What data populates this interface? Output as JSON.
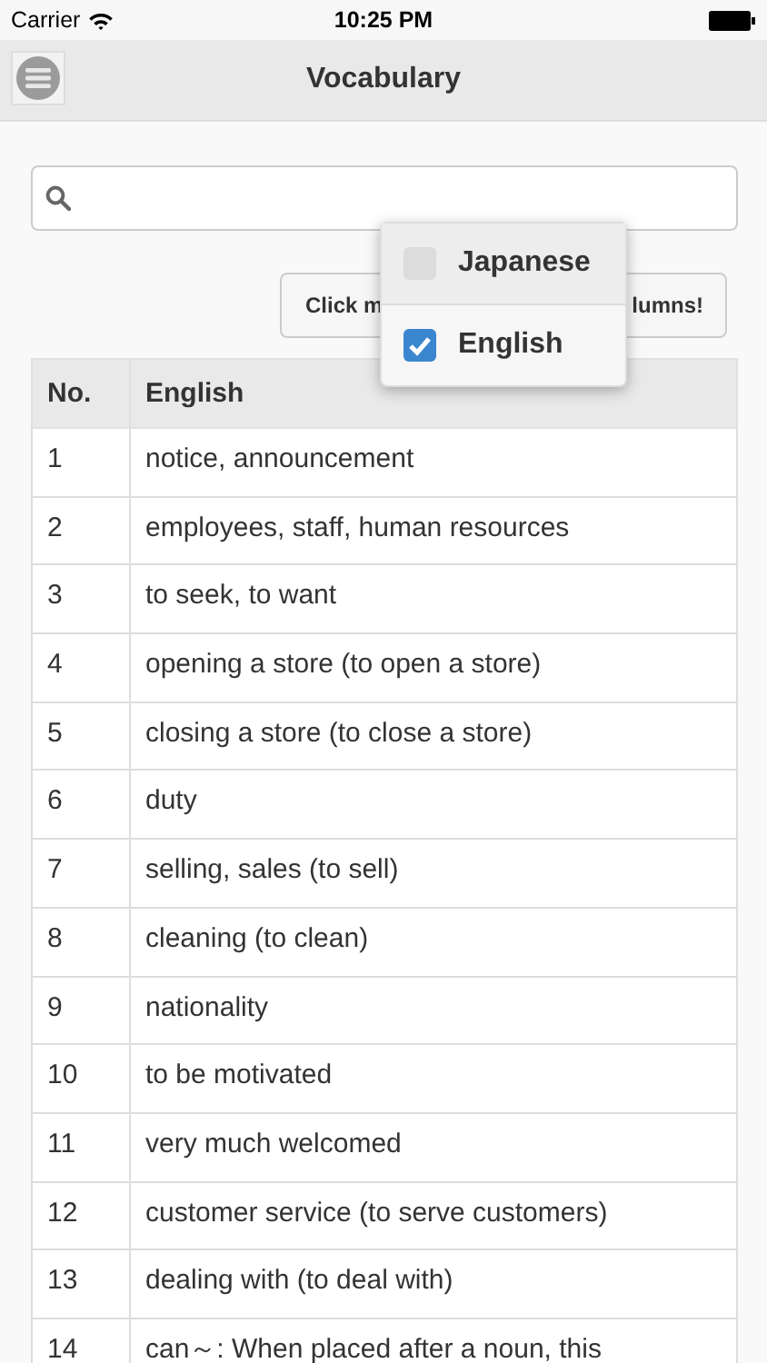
{
  "status_bar": {
    "carrier": "Carrier",
    "time": "10:25 PM"
  },
  "nav": {
    "title": "Vocabulary"
  },
  "columns_button": {
    "label_start": "Click m",
    "label_end": "lumns!"
  },
  "column_menu": [
    {
      "label": "Japanese",
      "checked": false
    },
    {
      "label": "English",
      "checked": true
    }
  ],
  "table": {
    "columns": [
      "No.",
      "English"
    ],
    "rows": [
      [
        "1",
        "notice, announcement"
      ],
      [
        "2",
        "employees, staff, human resources"
      ],
      [
        "3",
        "to seek, to want"
      ],
      [
        "4",
        "opening a store (to open a store)"
      ],
      [
        "5",
        "closing a store (to close a store)"
      ],
      [
        "6",
        "duty"
      ],
      [
        "7",
        "selling, sales (to sell)"
      ],
      [
        "8",
        "cleaning (to clean)"
      ],
      [
        "9",
        "nationality"
      ],
      [
        "10",
        "to be motivated"
      ],
      [
        "11",
        "very much welcomed"
      ],
      [
        "12",
        "customer service (to serve customers)"
      ],
      [
        "13",
        "dealing with (to deal with)"
      ],
      [
        "14",
        "can～: When placed after a noun, this"
      ]
    ]
  }
}
